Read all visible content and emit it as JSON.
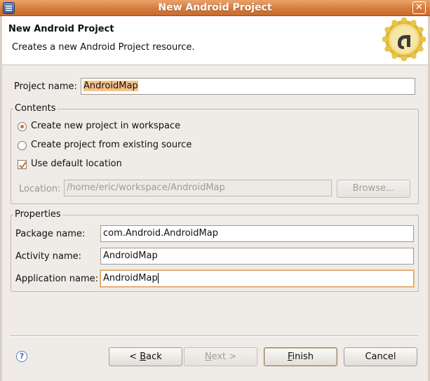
{
  "window": {
    "title": "New Android Project"
  },
  "banner": {
    "heading": "New Android Project",
    "description": "Creates a new Android Project resource."
  },
  "project": {
    "label": "Project name:",
    "value": "AndroidMap"
  },
  "contents": {
    "title": "Contents",
    "options": [
      {
        "label": "Create new project in workspace",
        "selected": true
      },
      {
        "label": "Create project from existing source",
        "selected": false
      }
    ],
    "default_location": {
      "label": "Use default location",
      "checked": true
    },
    "location": {
      "label": "Location:",
      "value": "/home/eric/workspace/AndroidMap",
      "browse_label": "Browse..."
    }
  },
  "properties": {
    "title": "Properties",
    "package": {
      "label": "Package name:",
      "value": "com.Android.AndroidMap"
    },
    "activity": {
      "label": "Activity name:",
      "value": "AndroidMap"
    },
    "application": {
      "label": "Application name:",
      "value": "AndroidMap"
    }
  },
  "buttons": {
    "back_prefix": "< ",
    "back_mnemonic": "B",
    "back_rest": "ack",
    "next_mnemonic": "N",
    "next_rest": "ext >",
    "finish_mnemonic": "F",
    "finish_rest": "inish",
    "cancel": "Cancel"
  },
  "icons": {
    "help": "?"
  }
}
